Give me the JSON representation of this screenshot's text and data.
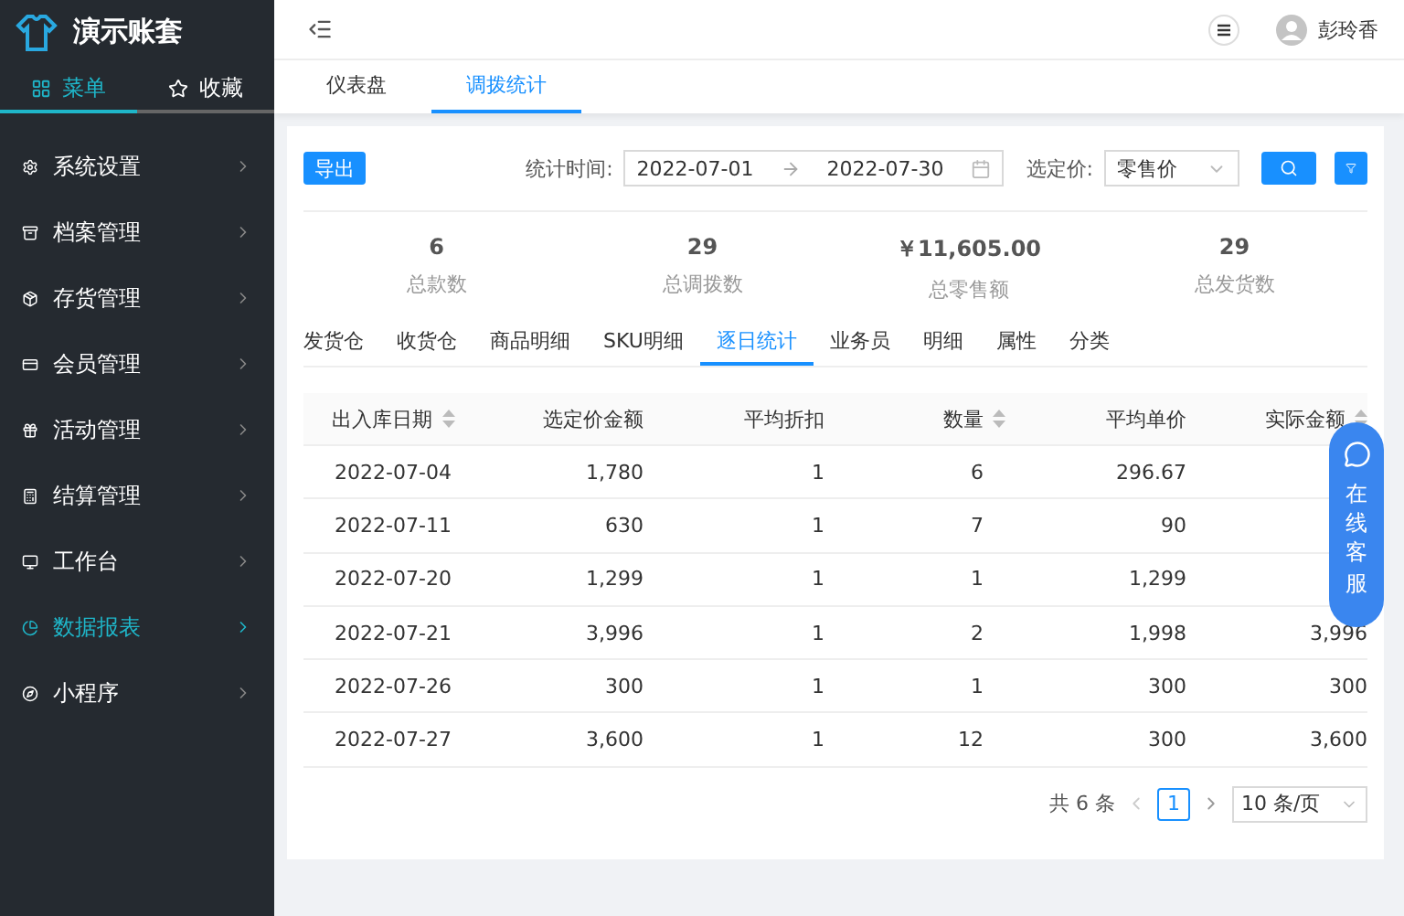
{
  "brand": {
    "title": "演示账套"
  },
  "sidebar_tabs": [
    {
      "label": "菜单",
      "selected": true,
      "kind": "grid"
    },
    {
      "label": "收藏",
      "selected": false,
      "kind": "star"
    }
  ],
  "sidebar_items": [
    {
      "label": "系统设置",
      "selected": false,
      "kind": "gear"
    },
    {
      "label": "档案管理",
      "selected": false,
      "kind": "archive"
    },
    {
      "label": "存货管理",
      "selected": false,
      "kind": "box"
    },
    {
      "label": "会员管理",
      "selected": false,
      "kind": "card"
    },
    {
      "label": "活动管理",
      "selected": false,
      "kind": "gift"
    },
    {
      "label": "结算管理",
      "selected": false,
      "kind": "calc"
    },
    {
      "label": "工作台",
      "selected": false,
      "kind": "monitor"
    },
    {
      "label": "数据报表",
      "selected": true,
      "kind": "pie"
    },
    {
      "label": "小程序",
      "selected": false,
      "kind": "compass"
    }
  ],
  "user": {
    "name": "彭玲香"
  },
  "page_tabs": [
    {
      "label": "仪表盘",
      "selected": false
    },
    {
      "label": "调拨统计",
      "selected": true
    }
  ],
  "toolbar": {
    "export": "导出",
    "date_label": "统计时间:",
    "date_start": "2022-07-01",
    "date_end": "2022-07-30",
    "price_label": "选定价:",
    "price_value": "零售价"
  },
  "stats": [
    {
      "value": "6",
      "label": "总款数"
    },
    {
      "value": "29",
      "label": "总调拨数"
    },
    {
      "value": "￥11,605.00",
      "label": "总零售额"
    },
    {
      "value": "29",
      "label": "总发货数"
    }
  ],
  "sub_tabs": [
    {
      "label": "发货仓",
      "selected": false
    },
    {
      "label": "收货仓",
      "selected": false
    },
    {
      "label": "商品明细",
      "selected": false
    },
    {
      "label": "SKU明细",
      "selected": false
    },
    {
      "label": "逐日统计",
      "selected": true
    },
    {
      "label": "业务员",
      "selected": false
    },
    {
      "label": "明细",
      "selected": false
    },
    {
      "label": "属性",
      "selected": false
    },
    {
      "label": "分类",
      "selected": false
    }
  ],
  "table": {
    "columns": [
      {
        "label": "出入库日期",
        "sortable": true
      },
      {
        "label": "选定价金额",
        "sortable": false
      },
      {
        "label": "平均折扣",
        "sortable": false
      },
      {
        "label": "数量",
        "sortable": true
      },
      {
        "label": "平均单价",
        "sortable": false
      },
      {
        "label": "实际金额",
        "sortable": true
      }
    ],
    "rows": [
      [
        "2022-07-04",
        "1,780",
        "1",
        "6",
        "296.67",
        null
      ],
      [
        "2022-07-11",
        "630",
        "1",
        "7",
        "90",
        null
      ],
      [
        "2022-07-20",
        "1,299",
        "1",
        "1",
        "1,299",
        null
      ],
      [
        "2022-07-21",
        "3,996",
        "1",
        "2",
        "1,998",
        "3,996"
      ],
      [
        "2022-07-26",
        "300",
        "1",
        "1",
        "300",
        "300"
      ],
      [
        "2022-07-27",
        "3,600",
        "1",
        "12",
        "300",
        "3,600"
      ]
    ]
  },
  "pagination": {
    "total": "共 6 条",
    "page": "1",
    "page_size": "10 条/页"
  },
  "chat_button": {
    "label": "在线客服"
  }
}
